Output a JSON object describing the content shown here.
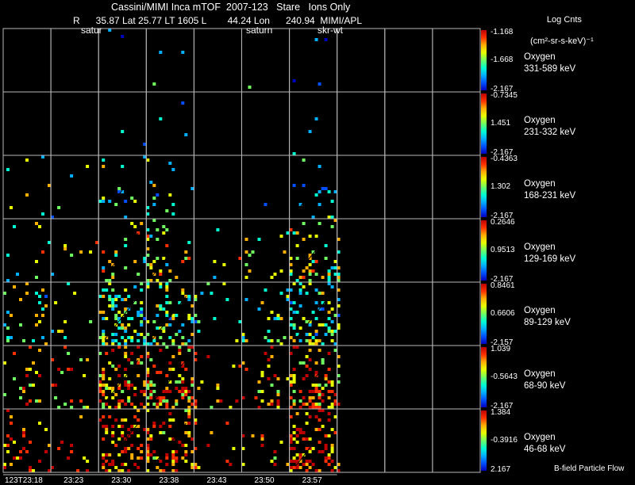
{
  "title": "Cassini/MIMI Inca mTOF  2007-123   Stare   Ions Only",
  "subtitle": "R      35.87 Lat 25.77 LT 1605 L        44.24 Lon      240.94  MIMI/APL",
  "tile_labels": [
    "satur",
    "saturn",
    "skr-wt"
  ],
  "colorbar_header": {
    "line1": "Log Cnts",
    "line2": "(cm²-sr-s-keV)⁻¹"
  },
  "footer_note": "B-field Particle Flow",
  "chart_data": {
    "type": "heatmap",
    "title": "Cassini/MIMI Inca mTOF  2007-123   Stare   Ions Only",
    "x_ticks": [
      "123T23:18",
      "23:23",
      "23:30",
      "23:38",
      "23:43",
      "23:50",
      "23:57"
    ],
    "colormap": [
      "#0000c0",
      "#0050ff",
      "#00b0ff",
      "#00ffd0",
      "#70ff60",
      "#e8ff00",
      "#ffb000",
      "#ff3000",
      "#c00000"
    ],
    "panels": [
      {
        "species": "Oxygen",
        "energy": "331-589 keV",
        "cb_max": "-1.168",
        "cb_mid": "-1.668",
        "cb_min": "-2.167"
      },
      {
        "species": "Oxygen",
        "energy": "231-332 keV",
        "cb_max": "-0.7345",
        "cb_mid": "1.451",
        "cb_min": "-2.167"
      },
      {
        "species": "Oxygen",
        "energy": "168-231 keV",
        "cb_max": "-0.4363",
        "cb_mid": "1.302",
        "cb_min": "-2.167"
      },
      {
        "species": "Oxygen",
        "energy": "129-169 keV",
        "cb_max": "0.2646",
        "cb_mid": "0.9513",
        "cb_min": "-2.167"
      },
      {
        "species": "Oxygen",
        "energy": "89-129 keV",
        "cb_max": "0.8461",
        "cb_mid": "0.6606",
        "cb_min": "-2.157"
      },
      {
        "species": "Oxygen",
        "energy": "68-90 keV",
        "cb_max": "1.039",
        "cb_mid": "-0.5643",
        "cb_min": "-2.167"
      },
      {
        "species": "Oxygen",
        "energy": "46-68 keV",
        "cb_max": "1.384",
        "cb_mid": "-0.3916",
        "cb_min": "2.167"
      }
    ]
  }
}
